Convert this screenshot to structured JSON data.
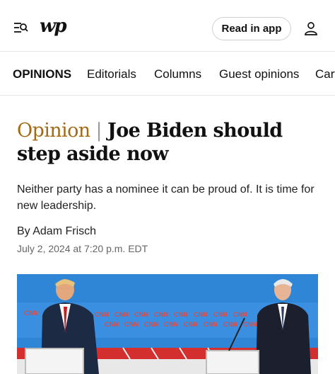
{
  "header": {
    "logo": "wp",
    "read_in_app": "Read in app",
    "icons": {
      "menu": "menu-search-icon",
      "account": "account-icon"
    }
  },
  "nav": {
    "items": [
      "OPINIONS",
      "Editorials",
      "Columns",
      "Guest opinions",
      "Cart"
    ]
  },
  "article": {
    "kicker": "Opinion",
    "separator": "|",
    "title": "Joe Biden should step aside now",
    "dek": "Neither party has a nominee it can be proud of. It is time for new leadership.",
    "byline_prefix": "By",
    "author": "Adam Frisch",
    "timestamp": "July 2, 2024 at 7:20 p.m. EDT"
  },
  "photo": {
    "backdrop_text": "CNN",
    "colors": {
      "sky": "#2f86d6",
      "stripe": "#d32f2f"
    }
  },
  "colors": {
    "kicker": "#a36a16",
    "border": "#e6e6e6"
  }
}
